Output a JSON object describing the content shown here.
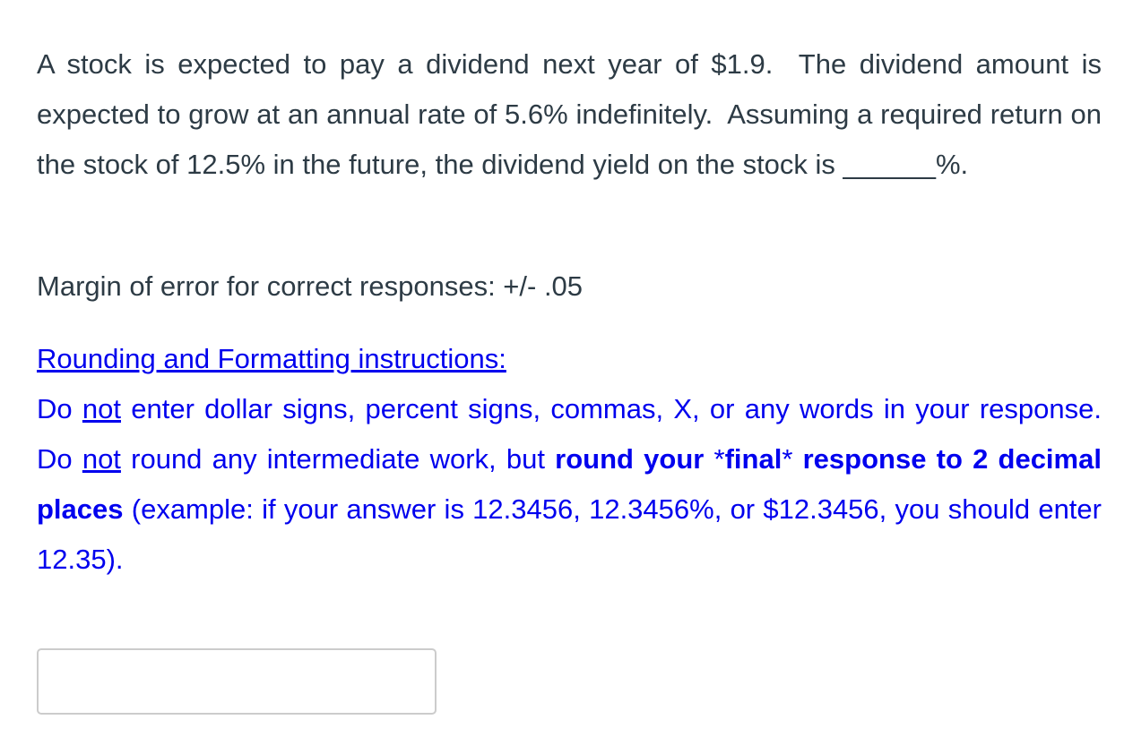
{
  "question": {
    "sentence1": "A stock is expected to pay a dividend next year of $1.9.",
    "sentence2": "The dividend amount is expected to grow at an annual rate of 5.6% indefinitely.",
    "sentence3": "Assuming a required return on the stock of 12.5% in the future, the dividend yield on the stock is ",
    "blank": "______",
    "suffix": "%."
  },
  "margin_of_error": "Margin of error for correct responses: +/- .05",
  "instructions": {
    "heading": "Rounding and Formatting instructions:",
    "part1_a": "Do ",
    "part1_not": "not",
    "part1_b": " enter dollar signs, percent signs, commas, X, or any words in your response. Do ",
    "part2_not": "not",
    "part2_b": " round any intermediate work, but ",
    "bold1": "round your",
    "star_a": " *",
    "bold2": "final",
    "star_b": "* ",
    "bold3": "response to 2 decimal places",
    "part3": " (example: if your answer is 12.3456, 12.3456%, or $12.3456, you should enter 12.35)."
  },
  "answer": {
    "value": "",
    "placeholder": ""
  },
  "colors": {
    "text": "#2d3b45",
    "link": "#0000ee",
    "input_border": "#cccccc"
  }
}
